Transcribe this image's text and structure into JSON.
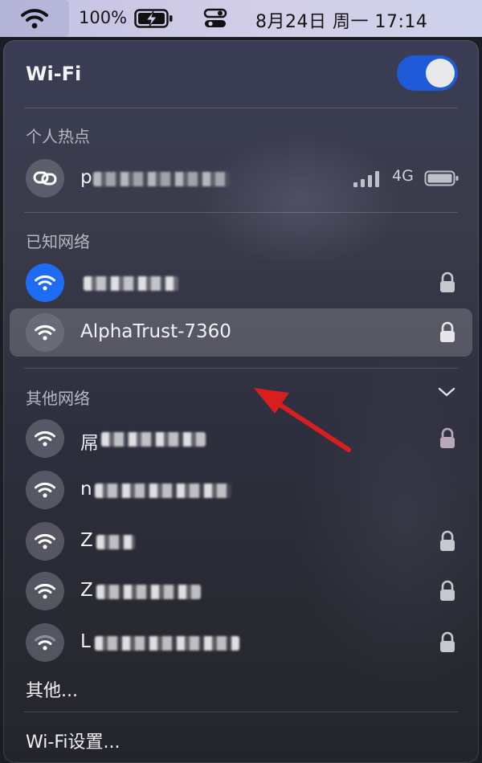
{
  "menubar": {
    "battery_percent": "100%",
    "clock": "8月24日 周一  17:14",
    "icons": [
      "wifi-icon",
      "battery-charging-icon",
      "control-center-icon"
    ]
  },
  "panel": {
    "title": "Wi-Fi",
    "wifi_enabled": true,
    "hotspot_section": "个人热点",
    "hotspot": {
      "name_visible_prefix": "p",
      "signal": "4G",
      "icon": "chain-link-icon"
    },
    "known_section": "已知网络",
    "known_networks": [
      {
        "name_visible": "",
        "connected": true,
        "locked": true
      },
      {
        "name": "AlphaTrust-7360",
        "connected": false,
        "locked": true,
        "highlighted": true
      }
    ],
    "other_section": "其他网络",
    "other_networks": [
      {
        "name_visible_prefix": "屌",
        "locked": true
      },
      {
        "name_visible_prefix": "n",
        "locked": false
      },
      {
        "name_visible_prefix": "Z",
        "locked": true
      },
      {
        "name_visible_prefix": "Z",
        "locked": true
      },
      {
        "name_visible_prefix": "L",
        "locked": true
      }
    ],
    "other_link": "其他...",
    "settings_link": "Wi-Fi设置..."
  },
  "colors": {
    "accent": "#1f5bd8",
    "connected_circle": "#1d6cf2",
    "arrow": "#d81e1e"
  }
}
